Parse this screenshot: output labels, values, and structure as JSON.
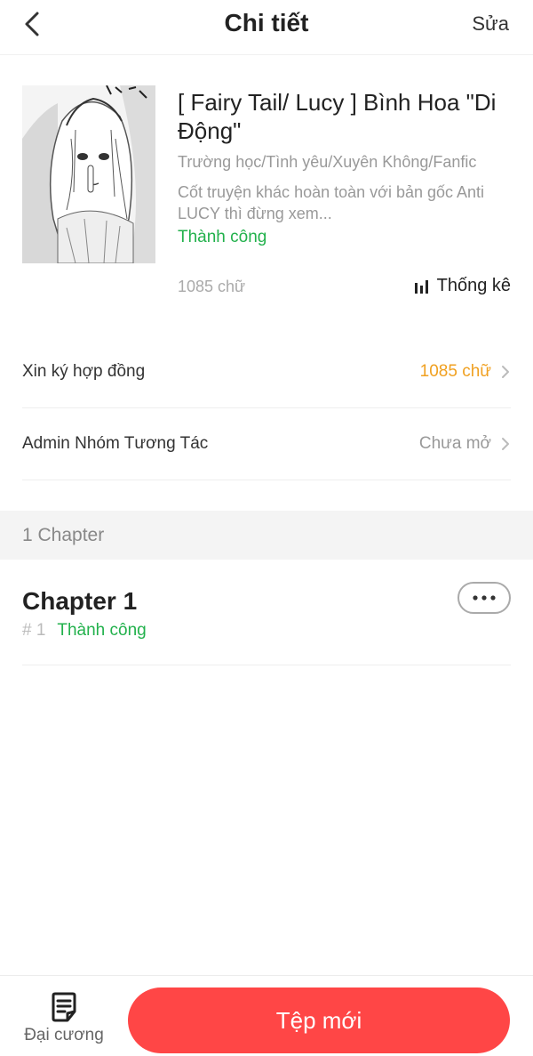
{
  "header": {
    "title": "Chi tiết",
    "edit_label": "Sửa"
  },
  "book": {
    "title": "[ Fairy Tail/ Lucy ] Bình Hoa \"Di Động\"",
    "genres": "Trường học/Tình yêu/Xuyên Không/Fanfic",
    "description": "Cốt truyện khác hoàn toàn với bản gốc Anti LUCY thì đừng xem...",
    "status": "Thành công",
    "word_count": "1085 chữ",
    "stats_label": "Thống kê"
  },
  "rows": [
    {
      "label": "Xin ký hợp đồng",
      "value": "1085 chữ",
      "value_color": "#f0a020"
    },
    {
      "label": "Admin Nhóm Tương Tác",
      "value": "Chưa mở",
      "value_color": "#999999"
    }
  ],
  "chapters_section": {
    "header": "1 Chapter",
    "items": [
      {
        "title": "Chapter 1",
        "number": "# 1",
        "status": "Thành công"
      }
    ]
  },
  "bottom_bar": {
    "outline_label": "Đại cương",
    "new_file_label": "Tệp mới"
  },
  "icons": {
    "back": "chevron-left-icon",
    "stats": "bar-chart-icon",
    "row_chevron": "chevron-right-icon",
    "more": "more-horizontal-icon",
    "outline": "document-list-icon"
  },
  "colors": {
    "accent": "#ff4646",
    "success": "#22b14c",
    "highlight": "#f0a020"
  }
}
